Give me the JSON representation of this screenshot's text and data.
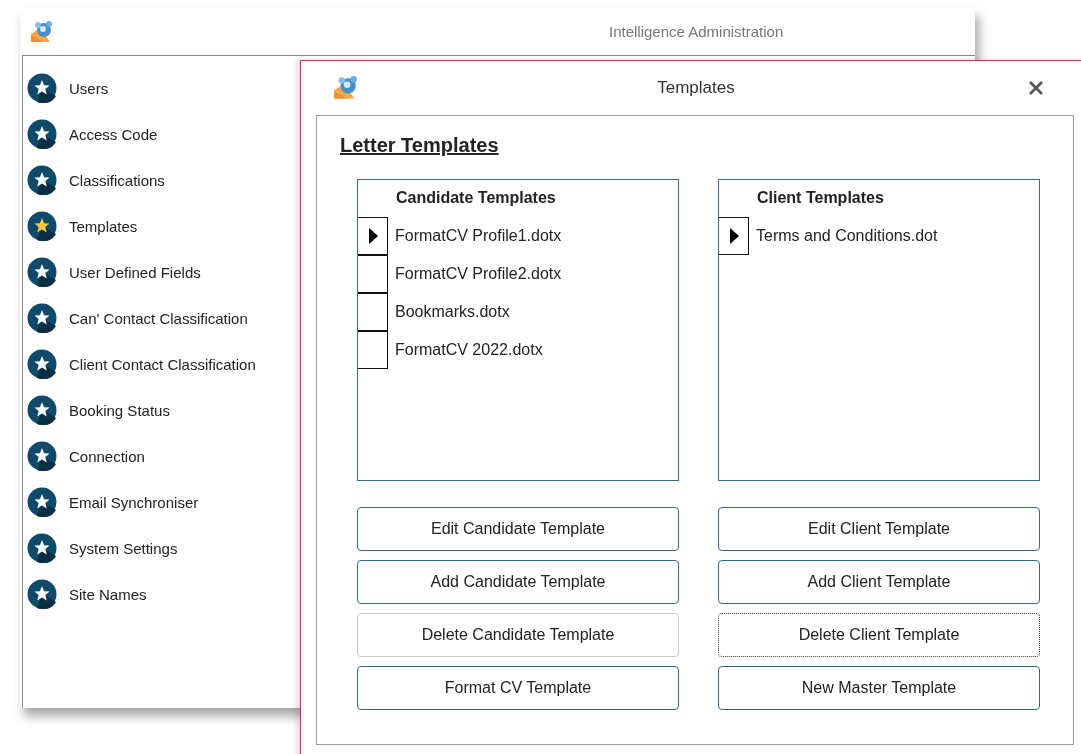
{
  "app_window": {
    "title": "Intelligence Administration"
  },
  "sidebar": {
    "items": [
      {
        "label": "Users",
        "selected": false
      },
      {
        "label": "Access Code",
        "selected": false
      },
      {
        "label": "Classifications",
        "selected": false
      },
      {
        "label": "Templates",
        "selected": true
      },
      {
        "label": "User Defined Fields",
        "selected": false
      },
      {
        "label": "Can' Contact Classification",
        "selected": false
      },
      {
        "label": "Client Contact Classification",
        "selected": false
      },
      {
        "label": "Booking Status",
        "selected": false
      },
      {
        "label": "Connection",
        "selected": false
      },
      {
        "label": "Email Synchroniser",
        "selected": false
      },
      {
        "label": "System Settings",
        "selected": false
      },
      {
        "label": "Site Names",
        "selected": false
      }
    ]
  },
  "dialog": {
    "title": "Templates",
    "section_title": "Letter Templates",
    "columns": [
      {
        "list": {
          "title": "Candidate Templates",
          "rows": [
            {
              "name": "FormatCV Profile1.dotx",
              "selected": true
            },
            {
              "name": "FormatCV Profile2.dotx",
              "selected": false
            },
            {
              "name": "Bookmarks.dotx",
              "selected": false
            },
            {
              "name": "FormatCV 2022.dotx",
              "selected": false
            }
          ]
        },
        "buttons": [
          {
            "label": "Edit Candidate Template",
            "disabled": false,
            "focused": false
          },
          {
            "label": "Add Candidate Template",
            "disabled": false,
            "focused": false
          },
          {
            "label": "Delete Candidate Template",
            "disabled": true,
            "focused": false
          },
          {
            "label": "Format CV Template",
            "disabled": false,
            "focused": false
          }
        ]
      },
      {
        "list": {
          "title": "Client Templates",
          "rows": [
            {
              "name": "Terms and Conditions.dot",
              "selected": true
            }
          ]
        },
        "buttons": [
          {
            "label": "Edit Client Template",
            "disabled": false,
            "focused": false
          },
          {
            "label": "Add Client Template",
            "disabled": false,
            "focused": false
          },
          {
            "label": "Delete Client Template",
            "disabled": false,
            "focused": true
          },
          {
            "label": "New Master Template",
            "disabled": false,
            "focused": false
          }
        ]
      }
    ]
  }
}
